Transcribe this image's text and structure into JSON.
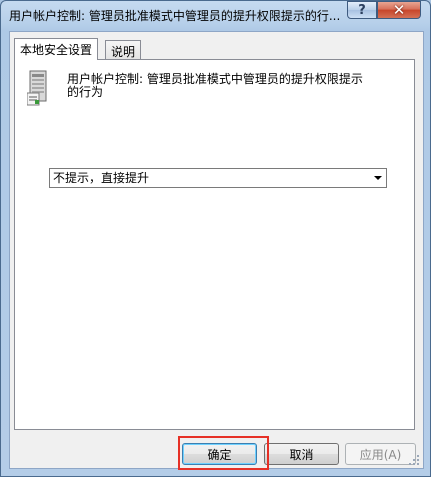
{
  "window": {
    "title": "用户帐户控制: 管理员批准模式中管理员的提升权限提示的行...",
    "help_glyph": "?",
    "close_glyph": "✕"
  },
  "tabs": [
    {
      "label": "本地安全设置",
      "active": true
    },
    {
      "label": "说明",
      "active": false
    }
  ],
  "policy": {
    "icon": "server-policy-icon",
    "title": "用户帐户控制: 管理员批准模式中管理员的提升权限提示\n的行为"
  },
  "setting": {
    "selected": "不提示，直接提升"
  },
  "buttons": {
    "ok": "确定",
    "cancel": "取消",
    "apply": "应用(A)"
  },
  "colors": {
    "highlight": "#e63026",
    "close_button": "#c7452a"
  }
}
